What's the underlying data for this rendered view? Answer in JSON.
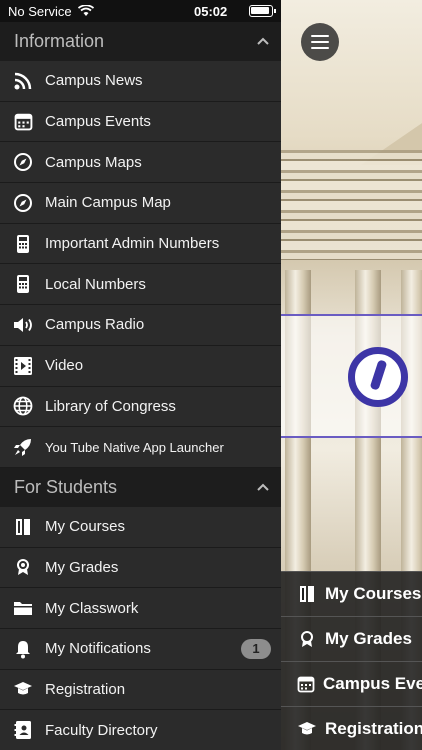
{
  "status_bar": {
    "carrier": "No Service",
    "time": "05:02"
  },
  "sections": {
    "information": {
      "title": "Information",
      "items": [
        {
          "label": "Campus News",
          "icon": "rss-icon"
        },
        {
          "label": "Campus Events",
          "icon": "calendar-icon"
        },
        {
          "label": "Campus Maps",
          "icon": "compass-icon"
        },
        {
          "label": "Main Campus Map",
          "icon": "compass-icon"
        },
        {
          "label": "Important Admin Numbers",
          "icon": "phone-icon"
        },
        {
          "label": "Local Numbers",
          "icon": "phone-icon"
        },
        {
          "label": "Campus Radio",
          "icon": "speaker-icon"
        },
        {
          "label": "Video",
          "icon": "film-icon"
        },
        {
          "label": "Library of Congress",
          "icon": "globe-icon"
        },
        {
          "label": "You Tube Native App Launcher",
          "icon": "rocket-icon"
        }
      ]
    },
    "students": {
      "title": "For Students",
      "items": [
        {
          "label": "My Courses",
          "icon": "book-icon"
        },
        {
          "label": "My Grades",
          "icon": "award-icon"
        },
        {
          "label": "My Classwork",
          "icon": "folder-icon"
        },
        {
          "label": "My Notifications",
          "icon": "bell-icon",
          "badge": "1"
        },
        {
          "label": "Registration",
          "icon": "graduation-cap-icon"
        },
        {
          "label": "Faculty Directory",
          "icon": "contact-book-icon"
        }
      ]
    }
  },
  "quick_bar": [
    {
      "label": "My Courses",
      "icon": "book-icon"
    },
    {
      "label": "My Grades",
      "icon": "award-icon"
    },
    {
      "label": "Campus Eve",
      "icon": "calendar-icon"
    },
    {
      "label": "Registration",
      "icon": "graduation-cap-icon"
    }
  ],
  "colors": {
    "drawer_bg": "#2b2b2b",
    "header_bg": "#1d1d1d",
    "badge_bg": "#8d8d8d",
    "logo_accent": "#3d35a6"
  }
}
